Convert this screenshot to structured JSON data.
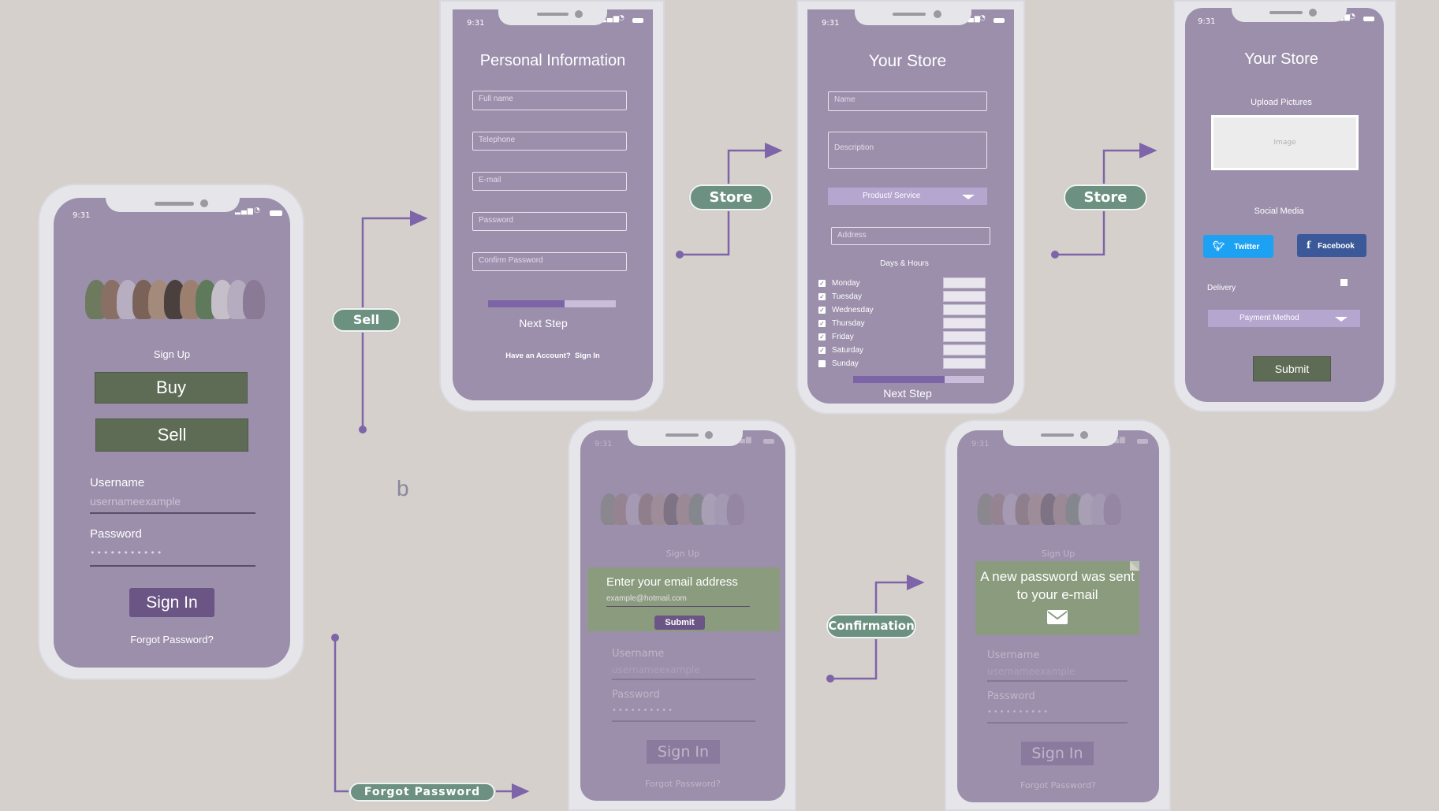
{
  "phone1": {
    "time": "9:31",
    "signup_label": "Sign Up",
    "buy_label": "Buy",
    "sell_label": "Sell",
    "username_label": "Username",
    "username_value": "usernameexample",
    "password_label": "Password",
    "password_value": "•••••••••••",
    "signin_label": "Sign In",
    "forgot_label": "Forgot Password?"
  },
  "phone2": {
    "time": "9:31",
    "title": "Personal Information",
    "fields": [
      "Full name",
      "Telephone",
      "E-mail",
      "Password",
      "Confirm Password"
    ],
    "progress": 0.6,
    "next_label": "Next Step",
    "account_text": "Have an Account?  Sign In"
  },
  "phone3": {
    "time": "9:31",
    "title": "Your Store",
    "name_placeholder": "Name",
    "description_placeholder": "Description",
    "product_select": "Product/ Service",
    "address_placeholder": "Address",
    "days_title": "Days & Hours",
    "days": [
      {
        "label": "Monday",
        "checked": true
      },
      {
        "label": "Tuesday",
        "checked": true
      },
      {
        "label": "Wednesday",
        "checked": true
      },
      {
        "label": "Thursday",
        "checked": true
      },
      {
        "label": "Friday",
        "checked": true
      },
      {
        "label": "Saturday",
        "checked": true
      },
      {
        "label": "Sunday",
        "checked": false
      }
    ],
    "progress": 0.7,
    "next_label": "Next Step"
  },
  "phone4": {
    "time": "9:31",
    "title": "Your Store",
    "upload_label": "Upload Pictures",
    "image_placeholder": "Image",
    "social_label": "Social Media",
    "twitter_label": "Twitter",
    "facebook_label": "Facebook",
    "delivery_label": "Delivery",
    "payment_select": "Payment Method",
    "submit_label": "Submit"
  },
  "phone5": {
    "time": "9:31",
    "signup_label": "Sign Up",
    "email_prompt": "Enter your email address",
    "email_placeholder": "example@hotmail.com",
    "submit_label": "Submit",
    "username_label": "Username",
    "username_value": "usernameexample",
    "password_label": "Password",
    "password_value": "••••••••••",
    "signin_label": "Sign In",
    "forgot_label": "Forgot Password?"
  },
  "phone6": {
    "time": "9:31",
    "signup_label": "Sign Up",
    "message": "A new password was sent to your e-mail",
    "username_label": "Username",
    "username_value": "usernameexample",
    "password_label": "Password",
    "password_value": "••••••••••",
    "signin_label": "Sign In",
    "forgot_label": "Forgot Password?"
  },
  "flow": {
    "sell_pill": "Sell",
    "store_pill_1": "Store",
    "store_pill_2": "Store",
    "confirmation_pill": "Confirmation",
    "forgot_pill": "Forgot Password",
    "stray_label": "b"
  },
  "colors": {
    "background": "#d5d0cb",
    "screen": "#9b8fab",
    "dark_green_button": "#5e6b55",
    "purple_button": "#6b5585",
    "pill_green": "#6c9180",
    "flow_line": "#7e64a8",
    "twitter": "#1da1f2",
    "facebook": "#3b5998"
  },
  "icons": [
    "signal-icon",
    "wifi-icon",
    "battery-icon",
    "twitter-icon",
    "facebook-icon",
    "chevron-down-icon",
    "envelope-icon",
    "checkbox-icon"
  ]
}
